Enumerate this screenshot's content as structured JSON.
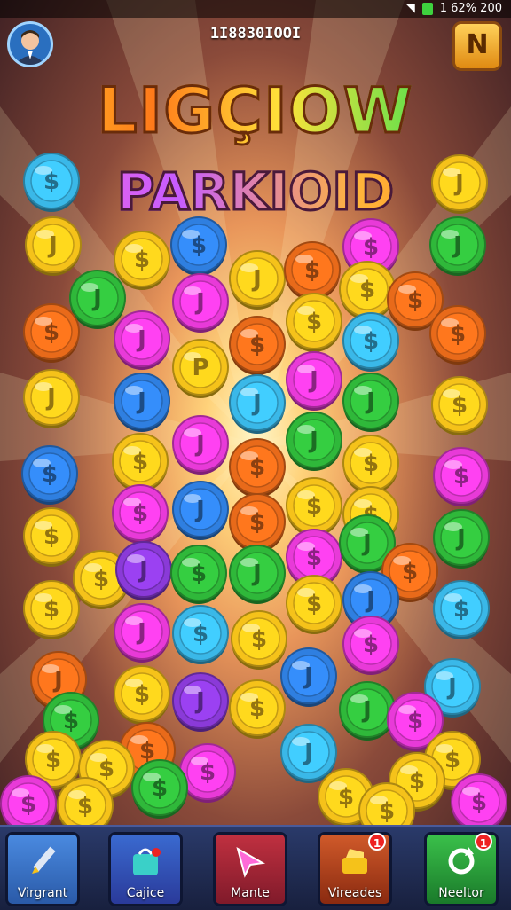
{
  "status_bar": {
    "right_text": "1 62% 200"
  },
  "header": {
    "score": "1I8830IOOI",
    "corner_button": "N"
  },
  "title": {
    "line1": "LIGÇIOW",
    "line2": "PARKIOID"
  },
  "bottom_nav": [
    {
      "label": "Virgrant",
      "icon": "pencil-icon",
      "badge": ""
    },
    {
      "label": "Cajice",
      "icon": "bag-icon",
      "badge": ""
    },
    {
      "label": "Mante",
      "icon": "cursor-icon",
      "badge": ""
    },
    {
      "label": "Vireades",
      "icon": "chest-icon",
      "badge": "1"
    },
    {
      "label": "Neeltor",
      "icon": "refresh-icon",
      "badge": "1"
    }
  ],
  "coin_colors": {
    "gold": "#f5c21a",
    "magenta": "#e83ad8",
    "blue": "#2f7fe0",
    "green": "#2fb83a",
    "orange": "#e86a1a",
    "cyan": "#3ab8e8",
    "purple": "#8a3ad8",
    "lime": "#7ad02a"
  }
}
